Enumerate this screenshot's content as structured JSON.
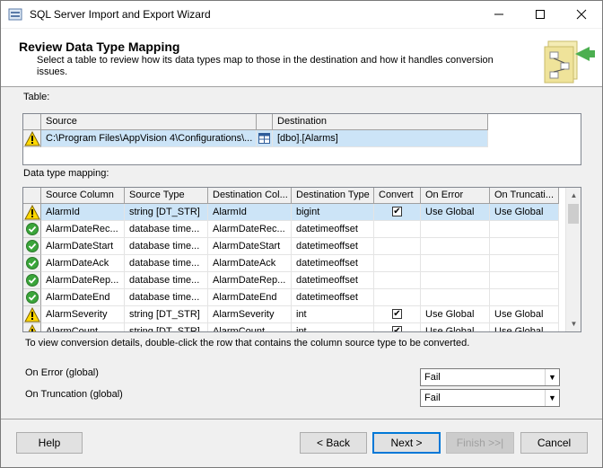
{
  "window": {
    "title": "SQL Server Import and Export Wizard"
  },
  "header": {
    "title": "Review Data Type Mapping",
    "description": "Select a table to review how its data types map to those in the destination and how it handles conversion issues."
  },
  "table_section": {
    "label": "Table:",
    "columns": {
      "source": "Source",
      "destination": "Destination"
    },
    "row": {
      "source": "C:\\Program Files\\AppVision 4\\Configurations\\...",
      "destination": "[dbo].[Alarms]"
    }
  },
  "mapping_section": {
    "label": "Data type mapping:",
    "columns": [
      "Source Column",
      "Source Type",
      "Destination Col...",
      "Destination Type",
      "Convert",
      "On Error",
      "On Truncati..."
    ],
    "rows": [
      {
        "status": "warning",
        "source_column": "AlarmId",
        "source_type": "string [DT_STR]",
        "dest_column": "AlarmId",
        "dest_type": "bigint",
        "convert": true,
        "on_error": "Use Global",
        "on_truncation": "Use Global"
      },
      {
        "status": "ok",
        "source_column": "AlarmDateRec...",
        "source_type": "database time...",
        "dest_column": "AlarmDateRec...",
        "dest_type": "datetimeoffset",
        "convert": false,
        "on_error": "",
        "on_truncation": ""
      },
      {
        "status": "ok",
        "source_column": "AlarmDateStart",
        "source_type": "database time...",
        "dest_column": "AlarmDateStart",
        "dest_type": "datetimeoffset",
        "convert": false,
        "on_error": "",
        "on_truncation": ""
      },
      {
        "status": "ok",
        "source_column": "AlarmDateAck",
        "source_type": "database time...",
        "dest_column": "AlarmDateAck",
        "dest_type": "datetimeoffset",
        "convert": false,
        "on_error": "",
        "on_truncation": ""
      },
      {
        "status": "ok",
        "source_column": "AlarmDateRep...",
        "source_type": "database time...",
        "dest_column": "AlarmDateRep...",
        "dest_type": "datetimeoffset",
        "convert": false,
        "on_error": "",
        "on_truncation": ""
      },
      {
        "status": "ok",
        "source_column": "AlarmDateEnd",
        "source_type": "database time...",
        "dest_column": "AlarmDateEnd",
        "dest_type": "datetimeoffset",
        "convert": false,
        "on_error": "",
        "on_truncation": ""
      },
      {
        "status": "warning",
        "source_column": "AlarmSeverity",
        "source_type": "string [DT_STR]",
        "dest_column": "AlarmSeverity",
        "dest_type": "int",
        "convert": true,
        "on_error": "Use Global",
        "on_truncation": "Use Global"
      },
      {
        "status": "warning",
        "source_column": "AlarmCount",
        "source_type": "string [DT_STR]",
        "dest_column": "AlarmCount",
        "dest_type": "int",
        "convert": true,
        "on_error": "Use Global",
        "on_truncation": "Use Global"
      }
    ]
  },
  "hint": "To view conversion details, double-click the row that contains the column source type to be converted.",
  "global_settings": {
    "on_error_label": "On Error (global)",
    "on_error_value": "Fail",
    "on_truncation_label": "On Truncation (global)",
    "on_truncation_value": "Fail"
  },
  "buttons": {
    "help": "Help",
    "back": "< Back",
    "next": "Next >",
    "finish": "Finish >>|",
    "cancel": "Cancel"
  }
}
